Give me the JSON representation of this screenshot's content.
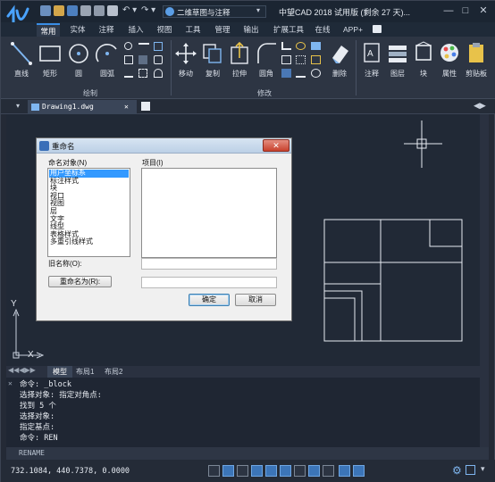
{
  "window": {
    "title": "中望CAD 2018 试用版 (剩余 27 天)...",
    "workspace": "二维草图与注释",
    "controls": [
      "—",
      "□",
      "✕"
    ]
  },
  "ribbon_tabs": [
    "常用",
    "实体",
    "注释",
    "插入",
    "视图",
    "工具",
    "管理",
    "输出",
    "扩展工具",
    "在线",
    "APP+"
  ],
  "ribbon": {
    "draw_tools": [
      "直线",
      "矩形",
      "圆",
      "圆弧"
    ],
    "modify_tools": [
      "移动",
      "复制",
      "拉伸",
      "圆角"
    ],
    "erase": "删除",
    "right_tools": [
      "注释",
      "图层",
      "块",
      "属性",
      "剪贴板"
    ],
    "section_draw": "绘制",
    "section_modify": "修改"
  },
  "document_tab": "Drawing1.dwg",
  "layout_tabs": [
    "模型",
    "布局1",
    "布局2"
  ],
  "ucs": {
    "x": "X",
    "y": "Y"
  },
  "command_lines": [
    "命令: _block",
    "选择对象: 指定对角点:",
    "找到 5 个",
    "选择对象:",
    "指定基点:",
    "命令: REN"
  ],
  "command_prompt": "RENAME",
  "coordinates": "732.1084, 440.7378, 0.0000",
  "dialog": {
    "title": "重命名",
    "named_objects_label": "命名对象(N)",
    "items_label": "项目(I)",
    "named_objects": [
      "用户坐标系",
      "标注样式",
      "块",
      "视口",
      "视图",
      "层",
      "文字",
      "线型",
      "表格样式",
      "多重引线样式"
    ],
    "selected_index": 0,
    "old_name_label": "旧名称(O):",
    "rename_to_button": "重命名为(R):",
    "ok_button": "确定",
    "cancel_button": "取消"
  },
  "colors": {
    "accent": "#3a8ee6",
    "selection": "#3399ff",
    "canvas": "#212936"
  }
}
